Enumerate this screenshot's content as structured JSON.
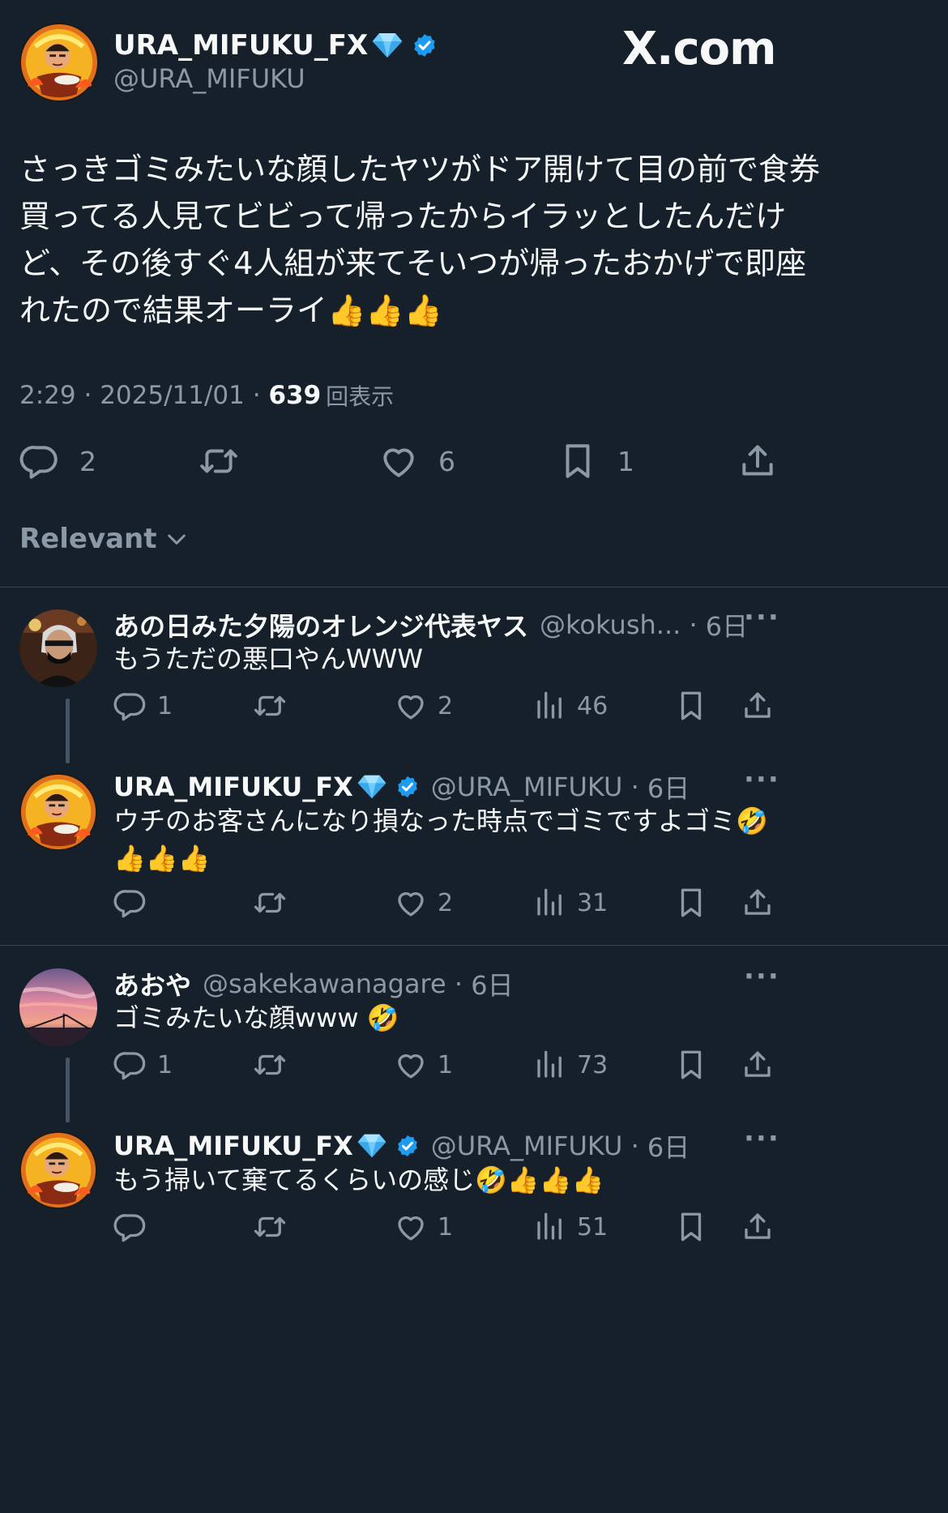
{
  "brand": {
    "logo_text": "X.com"
  },
  "main_tweet": {
    "display_name": "URA_MIFUKU_FX",
    "handle": "@URA_MIFUKU",
    "text_lines": [
      "さっきゴミみたいな顔したヤツがドア開けて目の前で食券",
      "買ってる人見てビビって帰ったからイラッとしたんだけ",
      "ど、その後すぐ4人組が来てそいつが帰ったおかげで即座",
      "れたので結果オーライ👍👍👍"
    ],
    "time": "2:29",
    "date": "2025/11/01",
    "views": "639",
    "views_label": "回表示",
    "replies": "2",
    "retweets": "",
    "likes": "6",
    "bookmarks": "1"
  },
  "sort_label": "Relevant",
  "replies": [
    {
      "display_name": "あの日みた夕陽のオレンジ代表ヤス",
      "handle": "@kokush...",
      "age": "6日",
      "text_lines": [
        "もうただの悪口やんWWW"
      ],
      "replies": "1",
      "retweets": "",
      "likes": "2",
      "views": "46",
      "avatar": "masked-person",
      "verified": false
    },
    {
      "display_name": "URA_MIFUKU_FX",
      "handle": "@URA_MIFUKU",
      "age": "6日",
      "text_lines": [
        "ウチのお客さんになり損なった時点でゴミですよゴミ🤣",
        "👍👍👍"
      ],
      "replies": "",
      "retweets": "",
      "likes": "2",
      "views": "31",
      "avatar": "ramen-man",
      "verified": true
    },
    {
      "display_name": "あおや",
      "handle": "@sakekawanagare",
      "age": "6日",
      "text_lines": [
        "ゴミみたいな顔www 🤣"
      ],
      "replies": "1",
      "retweets": "",
      "likes": "1",
      "views": "73",
      "avatar": "sunset",
      "verified": false
    },
    {
      "display_name": "URA_MIFUKU_FX",
      "handle": "@URA_MIFUKU",
      "age": "6日",
      "text_lines": [
        "もう掃いて棄てるくらいの感じ🤣👍👍👍"
      ],
      "replies": "",
      "retweets": "",
      "likes": "1",
      "views": "51",
      "avatar": "ramen-man",
      "verified": true
    }
  ],
  "colors": {
    "background": "#15202b",
    "text": "#f7f9f9",
    "muted": "#8b98a5",
    "verified": "#1d9bf0",
    "divider": "#38444d"
  }
}
